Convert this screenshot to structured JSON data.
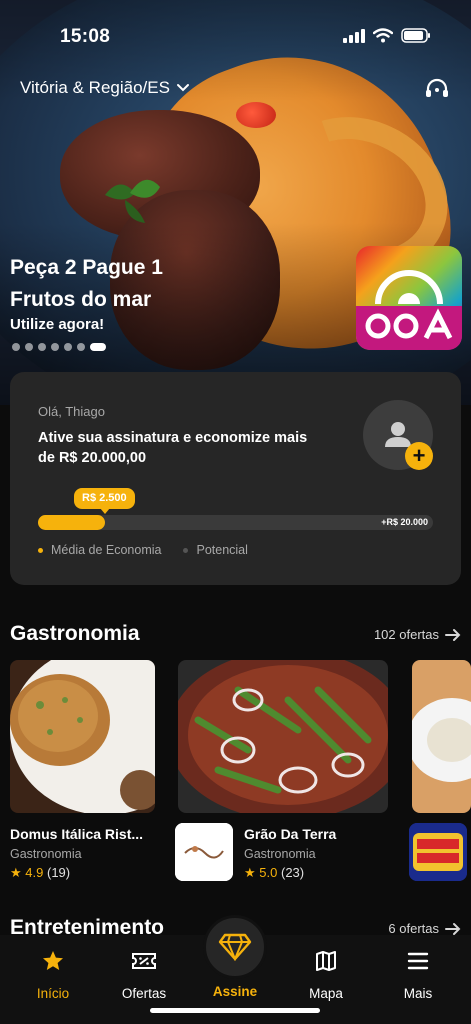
{
  "status_bar": {
    "time": "15:08"
  },
  "header": {
    "location": "Vitória & Região/ES"
  },
  "promo": {
    "title_line1": "Peça 2 Pague 1",
    "title_line2": "Frutos do mar",
    "cta": "Utilize agora!",
    "slide_count": 7,
    "active_slide": 6
  },
  "savings": {
    "greeting": "Olá, Thiago",
    "message": "Ative sua assinatura e economize mais de  R$ 20.000,00",
    "current_label": "R$ 2.500",
    "max_label": "+R$ 20.000",
    "progress_fraction": 0.17,
    "legend": [
      {
        "label": "Média de Economia",
        "color": "#f6b20c"
      },
      {
        "label": "Potencial",
        "color": "#555555"
      }
    ],
    "add_symbol": "+"
  },
  "gastronomia": {
    "title": "Gastronomia",
    "offers": "102 ofertas",
    "items": [
      {
        "name": "Domus Itálica Rist...",
        "category": "Gastronomia",
        "rating": "4.9",
        "reviews": "(19)"
      },
      {
        "name": "Grão Da Terra",
        "category": "Gastronomia",
        "rating": "5.0",
        "reviews": "(23)"
      }
    ]
  },
  "entretenimento": {
    "title": "Entretenimento",
    "offers": "6 ofertas"
  },
  "tabbar": {
    "items": [
      {
        "label": "Início",
        "icon": "star-icon",
        "active": true
      },
      {
        "label": "Ofertas",
        "icon": "ticket-icon"
      },
      {
        "label": "Assine",
        "icon": "diamond-icon"
      },
      {
        "label": "Mapa",
        "icon": "map-icon"
      },
      {
        "label": "Mais",
        "icon": "menu-icon"
      }
    ]
  },
  "colors": {
    "accent": "#f6b20c",
    "background": "#0c0c0c",
    "card": "#262626"
  }
}
